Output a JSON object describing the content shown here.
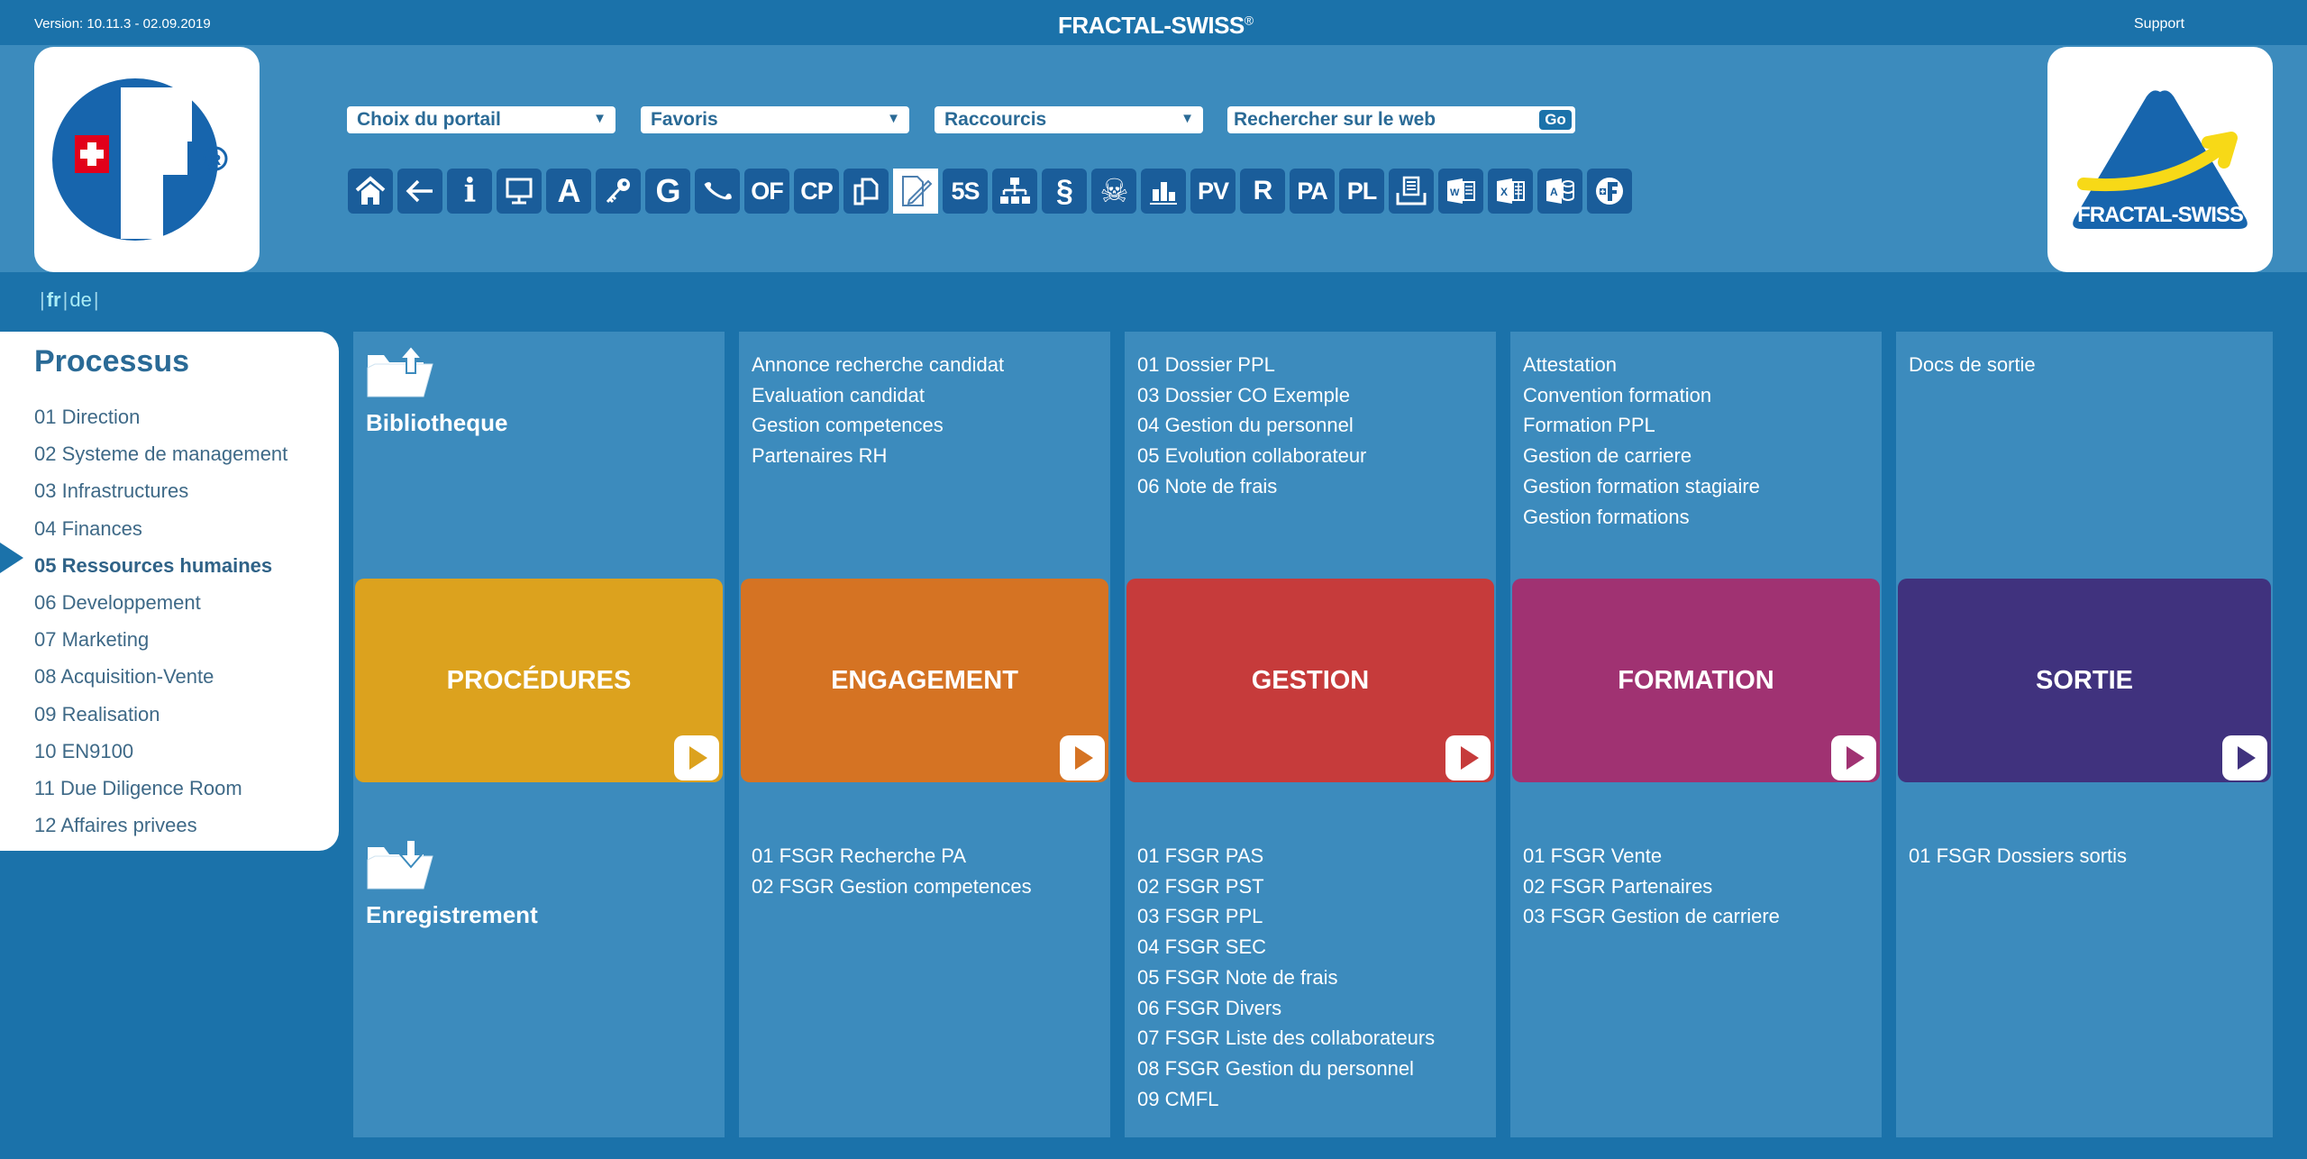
{
  "topbar": {
    "version": "Version: 10.11.3 - 02.09.2019",
    "brand": "FRACTAL-SWISS",
    "brand_mark": "®",
    "support": "Support"
  },
  "logos": {
    "left_alt": "Fractal logo F with swiss cross",
    "right_text": "FRACTAL-SWISS"
  },
  "header": {
    "portal_select": "Choix du portail",
    "favorites_select": "Favoris",
    "shortcuts_select": "Raccourcis",
    "search_placeholder": "Rechercher sur le web",
    "go_label": "Go",
    "toolbar": [
      {
        "name": "home-icon",
        "label": ""
      },
      {
        "name": "back-arrow-icon",
        "label": "←"
      },
      {
        "name": "info-icon",
        "label": "i"
      },
      {
        "name": "monitor-icon",
        "label": ""
      },
      {
        "name": "letter-a-button",
        "label": "A"
      },
      {
        "name": "key-icon",
        "label": ""
      },
      {
        "name": "letter-g-button",
        "label": "G"
      },
      {
        "name": "phone-icon",
        "label": ""
      },
      {
        "name": "of-button",
        "label": "OF"
      },
      {
        "name": "cp-button",
        "label": "CP"
      },
      {
        "name": "copy-documents-icon",
        "label": ""
      },
      {
        "name": "edit-document-icon",
        "label": ""
      },
      {
        "name": "5s-button",
        "label": "5S"
      },
      {
        "name": "org-chart-icon",
        "label": ""
      },
      {
        "name": "section-icon",
        "label": "§"
      },
      {
        "name": "skull-icon",
        "label": "☠"
      },
      {
        "name": "bar-chart-icon",
        "label": ""
      },
      {
        "name": "pv-button",
        "label": "PV"
      },
      {
        "name": "r-button",
        "label": "R"
      },
      {
        "name": "pa-button",
        "label": "PA"
      },
      {
        "name": "pl-button",
        "label": "PL"
      },
      {
        "name": "printer-icon",
        "label": ""
      },
      {
        "name": "word-icon",
        "label": "W"
      },
      {
        "name": "excel-icon",
        "label": "X"
      },
      {
        "name": "access-icon",
        "label": "A"
      },
      {
        "name": "fractal-logo-icon",
        "label": "F"
      }
    ]
  },
  "language": {
    "fr": "fr",
    "de": "de",
    "active": "fr"
  },
  "sidebar": {
    "title": "Processus",
    "active_index": 4,
    "items": [
      "01 Direction",
      "02 Systeme de management",
      "03 Infrastructures",
      "04 Finances",
      "05 Ressources humaines",
      "06 Developpement",
      "07 Marketing",
      "08 Acquisition-Vente",
      "09 Realisation",
      "10 EN9100",
      "11 Due Diligence Room",
      "12 Affaires privees"
    ]
  },
  "sections": {
    "bibliotheque": "Bibliotheque",
    "enregistrement": "Enregistrement"
  },
  "columns": [
    {
      "tile": "PROCÉDURES",
      "color": "#dca21e",
      "top": [],
      "bottom": []
    },
    {
      "tile": "ENGAGEMENT",
      "color": "#d57323",
      "top": [
        "Annonce recherche candidat",
        "Evaluation candidat",
        "Gestion competences",
        "Partenaires RH"
      ],
      "bottom": [
        "01 FSGR Recherche PA",
        "02 FSGR Gestion competences"
      ]
    },
    {
      "tile": "GESTION",
      "color": "#c63b3b",
      "top": [
        "01 Dossier PPL",
        "03 Dossier CO Exemple",
        "04 Gestion du personnel",
        "05 Evolution collaborateur",
        "06 Note de frais"
      ],
      "bottom": [
        "01 FSGR PAS",
        "02 FSGR PST",
        "03 FSGR PPL",
        "04 FSGR SEC",
        "05 FSGR Note de frais",
        "06 FSGR Divers",
        "07 FSGR Liste des collaborateurs",
        "08 FSGR Gestion du personnel",
        "09 CMFL"
      ]
    },
    {
      "tile": "FORMATION",
      "color": "#a03272",
      "top": [
        "Attestation",
        "Convention formation",
        "Formation PPL",
        "Gestion de carriere",
        "Gestion formation stagiaire",
        "Gestion formations"
      ],
      "bottom": [
        "01 FSGR Vente",
        "02 FSGR Partenaires",
        "03 FSGR Gestion de carriere"
      ]
    },
    {
      "tile": "SORTIE",
      "color": "#40327e",
      "top": [
        "Docs de sortie"
      ],
      "bottom": [
        "01 FSGR Dossiers sortis"
      ]
    }
  ]
}
